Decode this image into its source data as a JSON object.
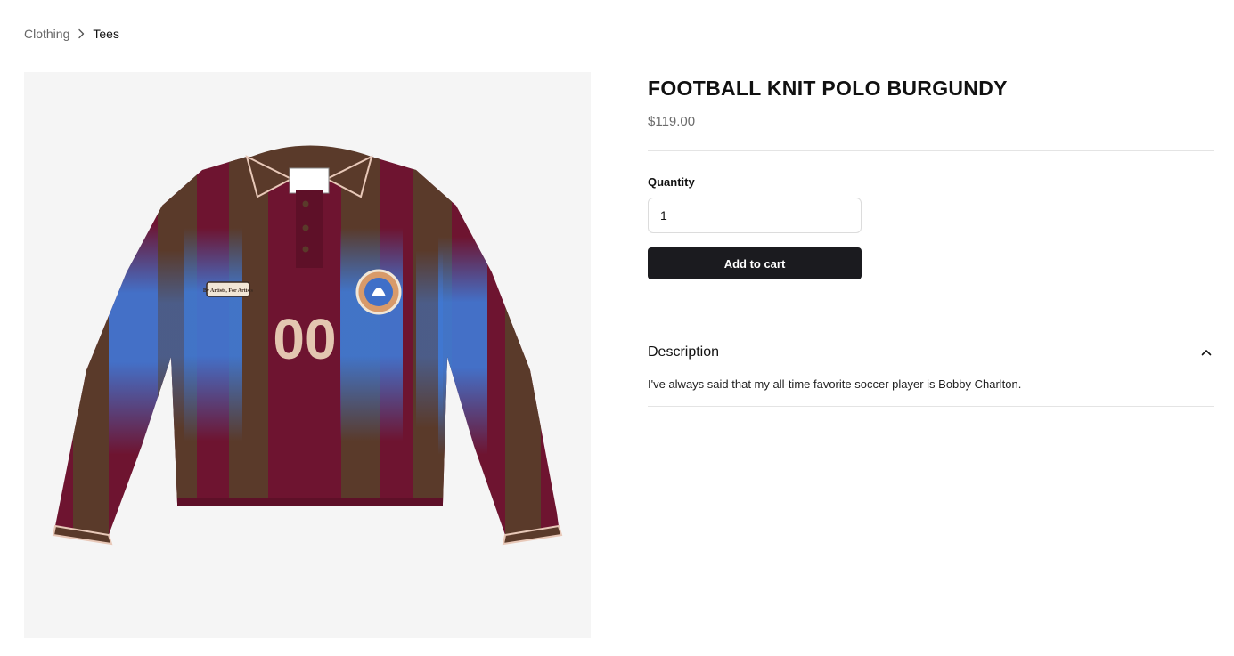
{
  "breadcrumb": {
    "items": [
      "Clothing"
    ],
    "current": "Tees"
  },
  "product": {
    "title": "FOOTBALL KNIT POLO BURGUNDY",
    "price": "$119.00",
    "image_alt": "Football knit polo in burgundy and brown stripes with blue gradient",
    "jersey_number": "00",
    "badge_text": "By Artists, For Artists"
  },
  "quantity": {
    "label": "Quantity",
    "value": "1"
  },
  "actions": {
    "add_to_cart": "Add to cart"
  },
  "description": {
    "heading": "Description",
    "text": "I've always said that my all-time favorite soccer player is Bobby Charlton.",
    "expanded": true
  },
  "icons": {
    "breadcrumb_separator": "chevron-right-icon",
    "accordion_toggle": "chevron-up-icon"
  },
  "colors": {
    "button_bg": "#1b1b1f",
    "image_bg": "#f5f5f5",
    "burgundy": "#6e1430",
    "brown": "#5a3a2a",
    "blue": "#3f7ad8"
  }
}
